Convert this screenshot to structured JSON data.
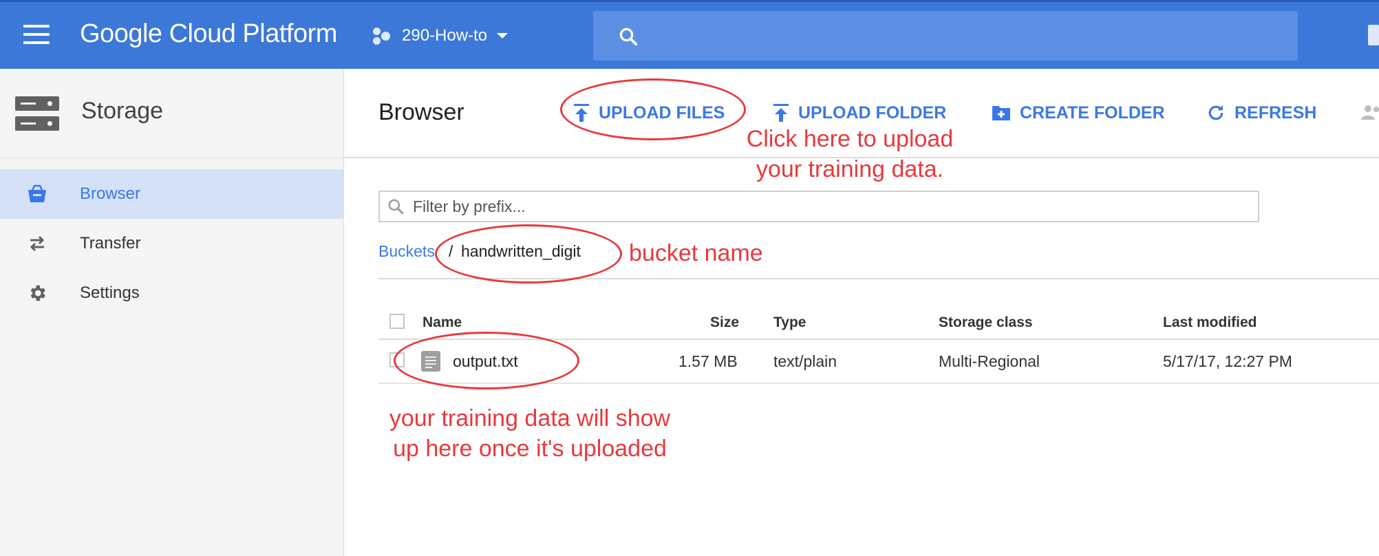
{
  "topbar": {
    "brand": "Google Cloud Platform",
    "project": "290-How-to",
    "color": "#3c78d8"
  },
  "sidebar": {
    "title": "Storage",
    "items": [
      {
        "label": "Browser",
        "icon": "bucket-icon",
        "selected": true
      },
      {
        "label": "Transfer",
        "icon": "transfer-arrows-icon",
        "selected": false
      },
      {
        "label": "Settings",
        "icon": "gear-icon",
        "selected": false
      }
    ]
  },
  "main": {
    "title": "Browser",
    "toolbar": {
      "upload_files": "UPLOAD FILES",
      "upload_folder": "UPLOAD FOLDER",
      "create_folder": "CREATE FOLDER",
      "refresh": "REFRESH"
    },
    "filter_placeholder": "Filter by prefix...",
    "breadcrumb": {
      "root": "Buckets",
      "separator": "/",
      "bucket": "handwritten_digit"
    },
    "table": {
      "columns": [
        "Name",
        "Size",
        "Type",
        "Storage class",
        "Last modified"
      ],
      "rows": [
        {
          "name": "output.txt",
          "size": "1.57 MB",
          "type": "text/plain",
          "storage_class": "Multi-Regional",
          "last_modified": "5/17/17, 12:27 PM"
        }
      ]
    }
  },
  "annotations": {
    "upload_note_line1": "Click here to upload",
    "upload_note_line2": "your training data.",
    "bucket_note": "bucket name",
    "data_note_line1": "your training data will show",
    "data_note_line2": "up here once it's uploaded",
    "color": "#e8393d"
  },
  "accent_color": "#3b78e7"
}
